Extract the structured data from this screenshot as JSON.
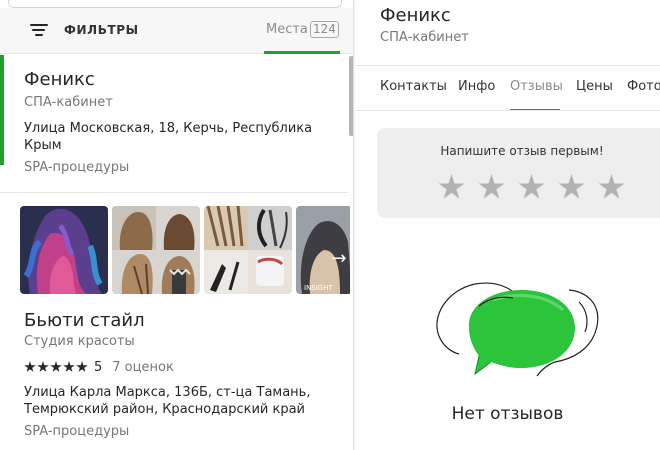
{
  "filters": {
    "label": "ФИЛЬТРЫ",
    "places_label": "Места",
    "places_count": "124"
  },
  "results": [
    {
      "title": "Феникс",
      "subtitle": "СПА-кабинет",
      "address": "Улица Московская, 18, Керчь, Республика Крым",
      "category": "SPA-процедуры"
    },
    {
      "title": "Бьюти стайл",
      "subtitle": "Студия красоты",
      "rating": "5",
      "rating_count": "7 оценок",
      "address": "Улица Карла Маркса, 136Б, ст-ца Тамань, Темрюкский район, Краснодарский край",
      "category": "SPA-процедуры",
      "photo_next_icon": "arrow-right-icon"
    }
  ],
  "detail": {
    "title": "Феникс",
    "subtitle": "СПА-кабинет",
    "tabs": [
      "Контакты",
      "Инфо",
      "Отзывы",
      "Цены",
      "Фото"
    ],
    "active_tab": "Отзывы",
    "review_prompt": "Напишите отзыв первым!",
    "star_count": 5,
    "empty_text": "Нет отзывов"
  },
  "colors": {
    "accent": "#1fa12b",
    "empty_star": "#b2b2b2"
  }
}
